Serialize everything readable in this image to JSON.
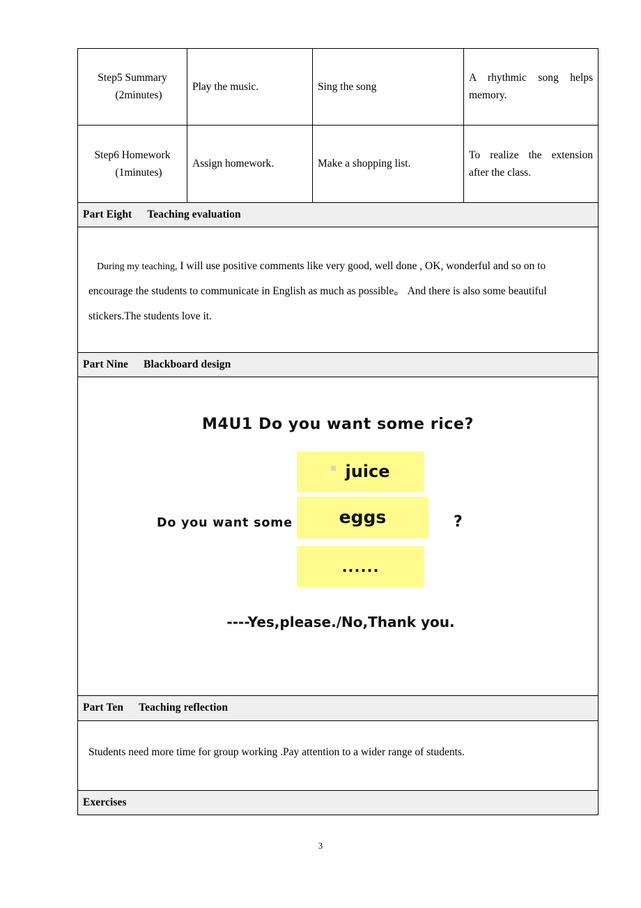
{
  "document": {
    "page_number": "3",
    "colors": {
      "section_header_bg": "#efefef",
      "highlight_yellow": "#fffb8c",
      "border": "#000000",
      "section_border": "#7a7a7a"
    }
  },
  "lesson_table": {
    "rows": [
      {
        "step_line1": "Step5 Summary",
        "step_line2": "(2minutes)",
        "teacher_activity": "Play the music.",
        "student_activity": "Sing the song",
        "purpose": "A rhythmic song helps memory."
      },
      {
        "step_line1": "Step6 Homework",
        "step_line2": "(1minutes)",
        "teacher_activity": "Assign homework.",
        "student_activity": "Make a shopping list.",
        "purpose": "To realize the extension after the class."
      }
    ]
  },
  "sections": {
    "evaluation": {
      "part_label": "Part Eight",
      "title": "Teaching evaluation",
      "paragraph_lead": "During my teaching,",
      "paragraph": " I will use positive comments like very good, well done , OK, wonderful and so on to encourage the students to communicate in English as much as possible。 And there is also some beautiful stickers.The students love it."
    },
    "blackboard": {
      "part_label": "Part Nine",
      "title": "Blackboard design",
      "board_title": "M4U1 Do you want some rice?",
      "prompt": "Do you want some",
      "question_mark": "?",
      "options": [
        {
          "label": "juice",
          "has_bullet": true
        },
        {
          "label": "eggs",
          "has_bullet": false
        },
        {
          "label": "......",
          "has_bullet": false
        }
      ],
      "answer_line": "----Yes,please./No,Thank you."
    },
    "reflection": {
      "part_label": "Part Ten",
      "title": "Teaching reflection",
      "paragraph": "Students need more time for group working .Pay attention to a wider range of students."
    },
    "exercises": {
      "title": "Exercises"
    }
  }
}
